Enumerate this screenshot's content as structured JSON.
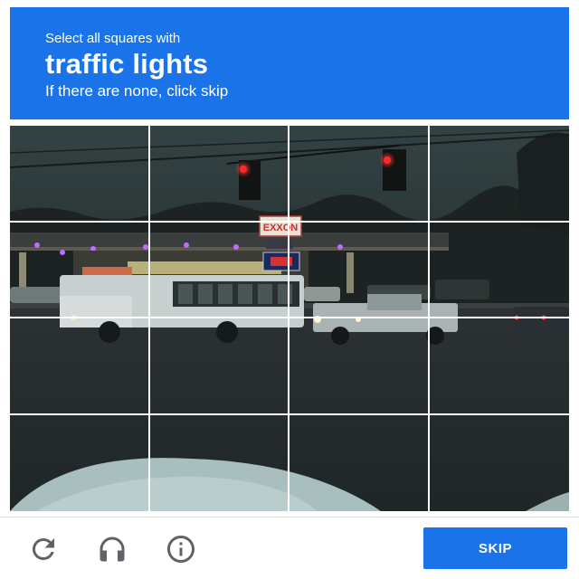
{
  "header": {
    "instruction": "Select all squares with",
    "target": "traffic lights",
    "hint": "If there are none, click skip"
  },
  "scene": {
    "sign_brand": "EXXON",
    "price_sign": "2.79"
  },
  "grid": {
    "rows": 4,
    "columns": 4,
    "selected_tiles": []
  },
  "footer": {
    "skip_label": "SKIP",
    "icons": [
      "reload-icon",
      "audio-challenge-icon",
      "info-icon"
    ]
  },
  "colors": {
    "accent": "#1a73e8",
    "icon_gray": "#5f6368"
  }
}
